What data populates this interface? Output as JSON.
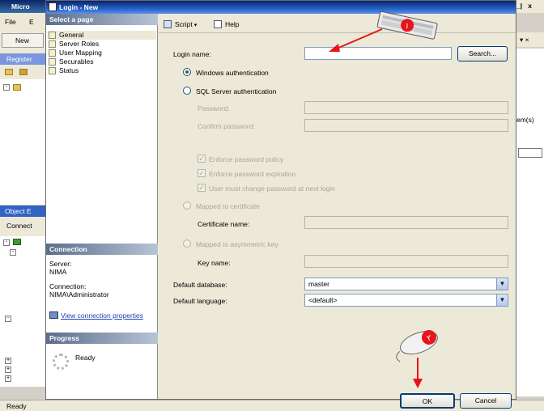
{
  "background_app": {
    "title": "Micro",
    "menu": [
      "File",
      "E"
    ],
    "toolbar_new": "New",
    "registered_panel": "Register",
    "object_explorer_panel": "Object E",
    "connect_label": "Connect",
    "right_title": "_|   x",
    "right_panel_close": "▾  ×",
    "right_items_label": "em(s)",
    "status_text": "Ready"
  },
  "dialog": {
    "title": "Login - New",
    "select_page_header": "Select a page",
    "pages": [
      {
        "label": "General",
        "selected": true
      },
      {
        "label": "Server Roles",
        "selected": false
      },
      {
        "label": "User Mapping",
        "selected": false
      },
      {
        "label": "Securables",
        "selected": false
      },
      {
        "label": "Status",
        "selected": false
      }
    ],
    "connection_header": "Connection",
    "server_label": "Server:",
    "server_value": "NIMA",
    "connection_label": "Connection:",
    "connection_value": "NIMA\\Administrator",
    "view_connection_link": "View connection properties",
    "progress_header": "Progress",
    "progress_status": "Ready",
    "toolbar": {
      "script_label": "Script",
      "help_label": "Help"
    },
    "form": {
      "login_name_label": "Login name:",
      "login_name_value": "",
      "search_button": "Search...",
      "windows_auth_label": "Windows authentication",
      "sql_auth_label": "SQL Server authentication",
      "password_label": "Password:",
      "confirm_password_label": "Confirm password:",
      "enforce_policy_label": "Enforce password policy",
      "enforce_expiration_label": "Enforce password expiration",
      "must_change_label": "User must change password at next login",
      "mapped_certificate_label": "Mapped to certificate",
      "certificate_name_label": "Certificate name:",
      "mapped_asymmetric_label": "Mapped to asymmetric key",
      "key_name_label": "Key name:",
      "default_database_label": "Default database:",
      "default_database_value": "master",
      "default_language_label": "Default language:",
      "default_language_value": "<default>"
    },
    "ok_button": "OK",
    "cancel_button": "Cancel"
  },
  "annotations": {
    "step_1_label": "۱",
    "step_2_label": "۲",
    "arrow_color": "#e8141c"
  }
}
